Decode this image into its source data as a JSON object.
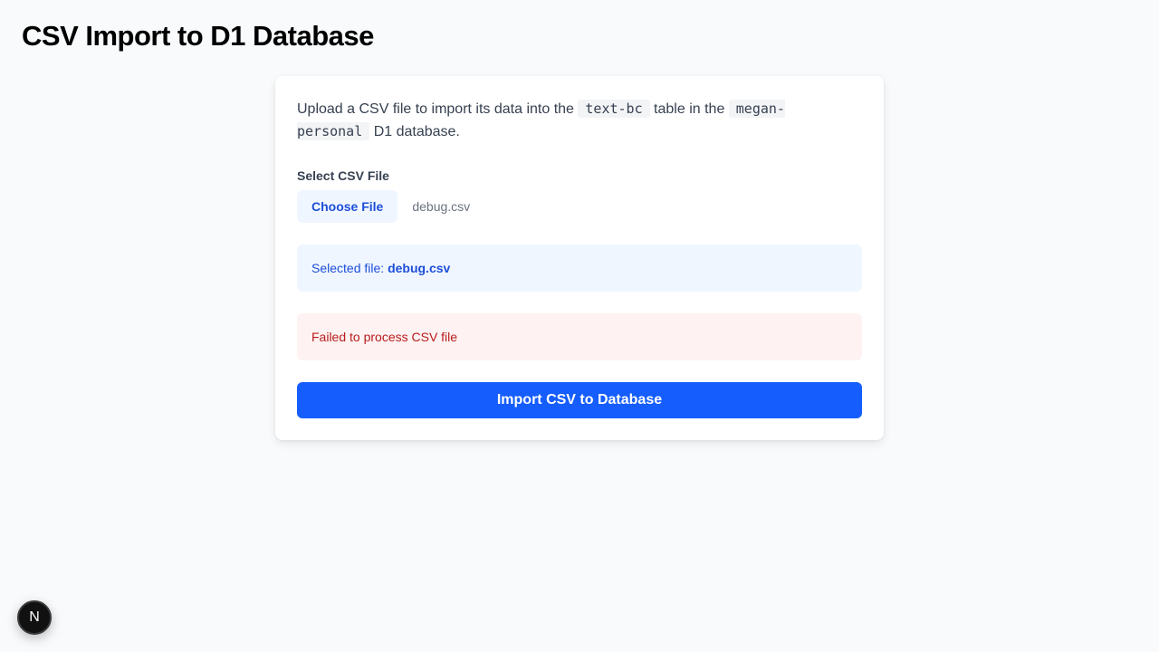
{
  "page": {
    "title": "CSV Import to D1 Database"
  },
  "card": {
    "description": {
      "part1": "Upload a CSV file to import its data into the ",
      "table_name": "text-bc",
      "part2": " table in the ",
      "database_name": "megan-personal",
      "part3": " D1 database."
    },
    "file_field": {
      "label": "Select CSV File",
      "button_label": "Choose File",
      "file_name": "debug.csv"
    },
    "selected_info": {
      "prefix": "Selected file: ",
      "file_name": "debug.csv"
    },
    "error_message": "Failed to process CSV file",
    "import_button_label": "Import CSV to Database"
  },
  "dev_badge": {
    "label": "N"
  },
  "colors": {
    "primary": "#155dfc",
    "info_bg": "#eff6ff",
    "info_text": "#1d4ed8",
    "error_bg": "#fef2f2",
    "error_text": "#b91c1c"
  }
}
